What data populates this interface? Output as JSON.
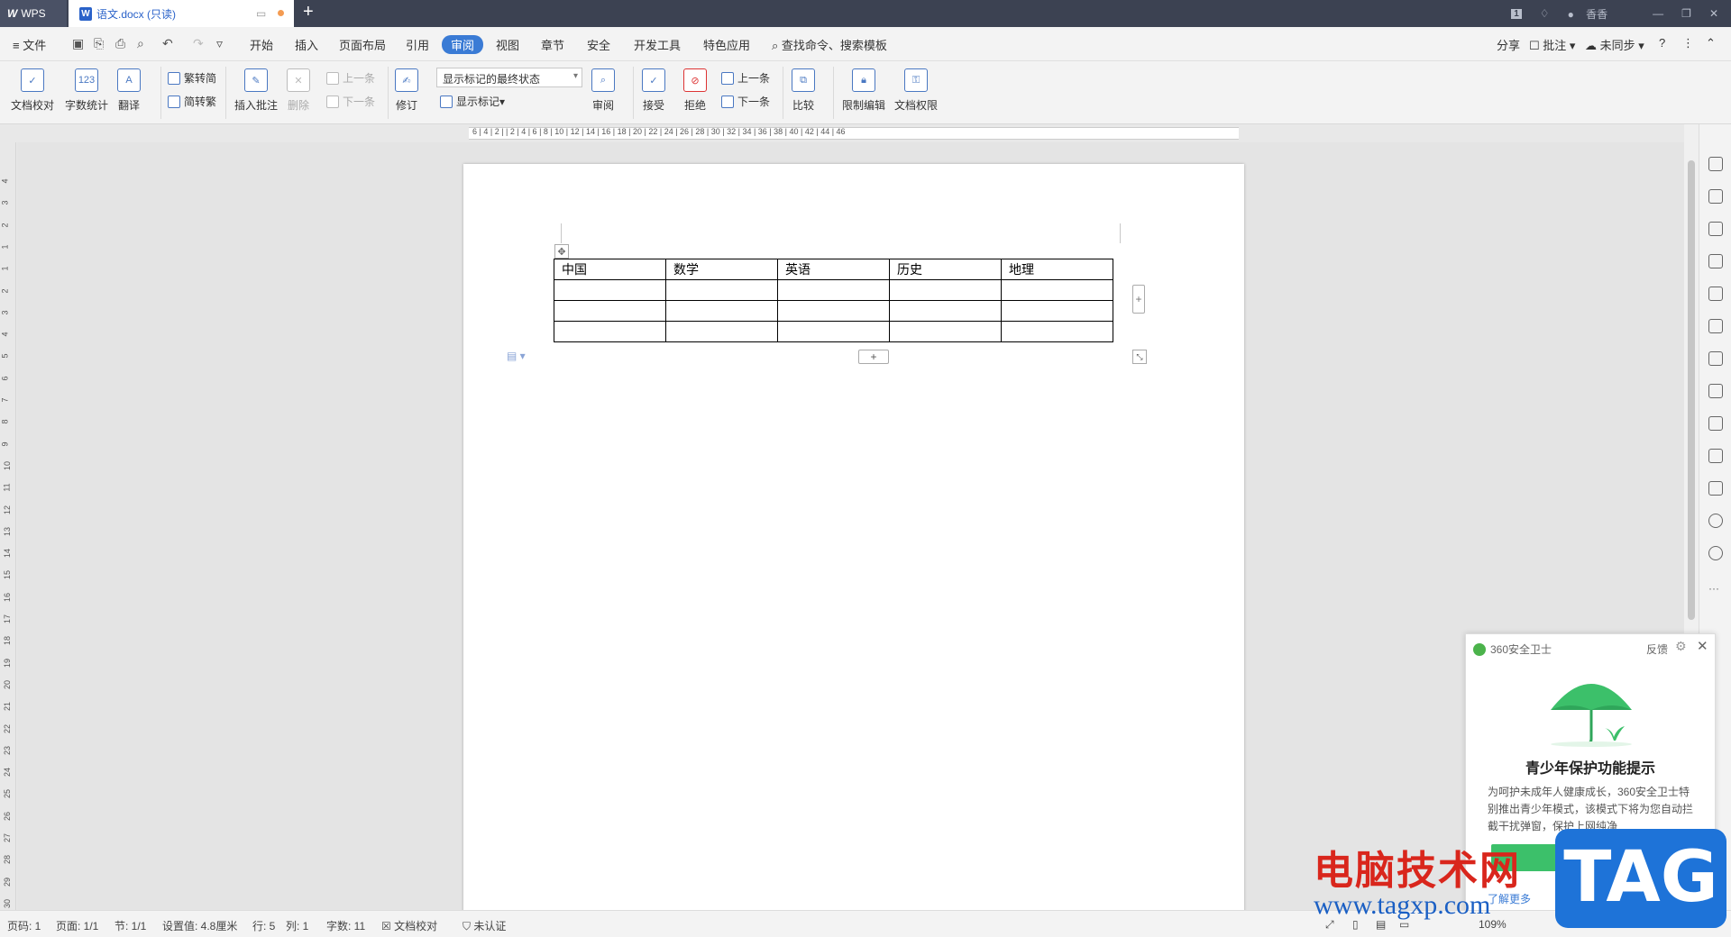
{
  "titlebar": {
    "app_name": "WPS",
    "doc_tab": "语文.docx (只读)",
    "doc_icon": "W",
    "new_tab": "+",
    "right_badge": "1",
    "user_name": "香香",
    "min": "—",
    "restore": "❐",
    "close": "✕"
  },
  "menubar": {
    "file": "≡ 文件",
    "tabs": [
      "开始",
      "插入",
      "页面布局",
      "引用",
      "审阅",
      "视图",
      "章节",
      "安全",
      "开发工具",
      "特色应用"
    ],
    "active_tab": "审阅",
    "search": "查找命令、搜索模板",
    "share": "分享",
    "comment": "批注",
    "sync": "未同步",
    "help": "?"
  },
  "ribbon": {
    "doc_check": "文档校对",
    "word_count": "字数统计",
    "translate": "翻译",
    "trad_simp": "繁转简",
    "simp_trad": "简转繁",
    "insert_comment": "插入批注",
    "delete": "删除",
    "prev_comment": "上一条",
    "next_comment": "下一条",
    "track": "修订",
    "markup_state": "显示标记的最终状态",
    "show_markup": "显示标记",
    "review": "审阅",
    "accept": "接受",
    "reject": "拒绝",
    "prev_change": "上一条",
    "next_change": "下一条",
    "compare": "比较",
    "restrict_edit": "限制编辑",
    "doc_permission": "文档权限"
  },
  "ruler": {
    "ticks": "6 | 4 | 2 |   | 2 | 4 | 6 | 8 | 10 | 12 | 14 | 16 | 18 | 20 | 22 | 24 | 26 | 28 | 30 | 32 | 34 | 36 | 38 | 40 | 42 | 44 | 46",
    "vticks": [
      "4",
      "3",
      "2",
      "1",
      "1",
      "2",
      "3",
      "4",
      "5",
      "6",
      "7",
      "8",
      "9",
      "10",
      "11",
      "12",
      "13",
      "14",
      "15",
      "16",
      "17",
      "18",
      "19",
      "20",
      "21",
      "22",
      "23",
      "24",
      "25",
      "26",
      "27",
      "28",
      "29",
      "30",
      "31"
    ]
  },
  "document": {
    "table_header": [
      "中国",
      "数学",
      "英语",
      "历史",
      "地理"
    ],
    "table_rows": [
      [
        "",
        "",
        "",
        "",
        ""
      ],
      [
        "",
        "",
        "",
        "",
        ""
      ],
      [
        "",
        "",
        "",
        "",
        ""
      ]
    ],
    "add_col": "+",
    "add_row": "+"
  },
  "popup": {
    "app": "360安全卫士",
    "feedback": "反馈",
    "title": "青少年保护功能提示",
    "body": "为呵护未成年人健康成长，360安全卫士特别推出青少年模式，该模式下将为您自动拦截干扰弹窗，保护上网纯净",
    "more": "了解更多"
  },
  "watermark": {
    "cn": "电脑技术网",
    "url": "www.tagxp.com",
    "tag": "TAG"
  },
  "statusbar": {
    "page_no": "页码: 1",
    "pages": "页面: 1/1",
    "section": "节: 1/1",
    "setting": "设置值: 4.8厘米",
    "row": "行: 5",
    "col": "列: 1",
    "words": "字数: 11",
    "check": "文档校对",
    "auth": "未认证",
    "zoom": "109%"
  }
}
